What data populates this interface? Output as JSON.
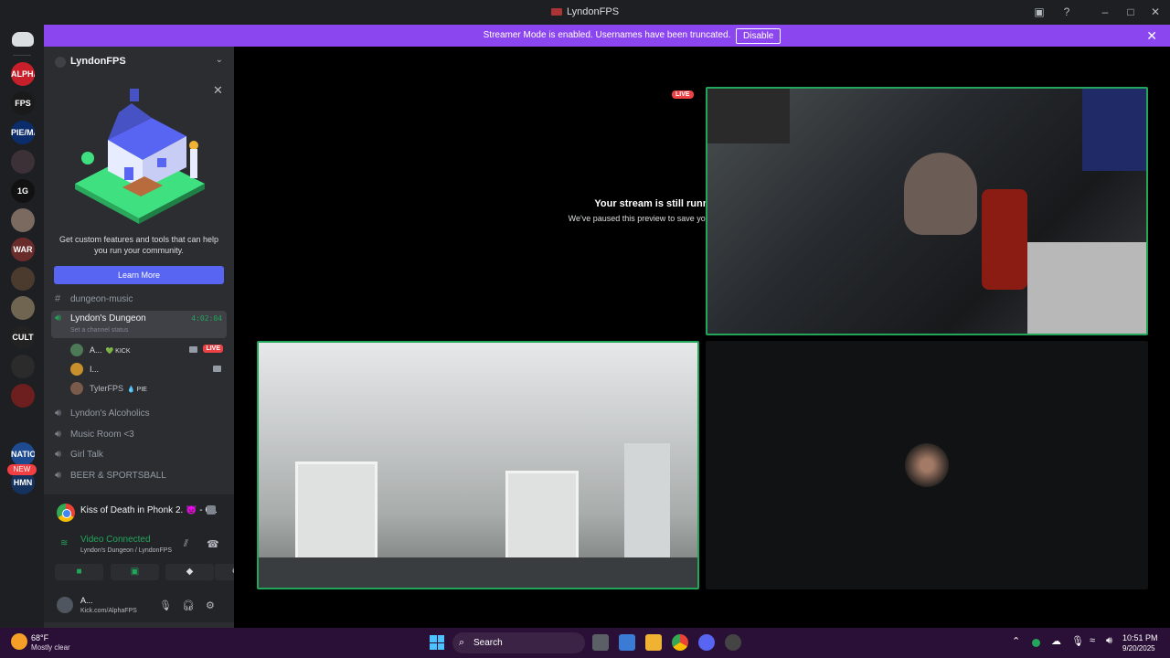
{
  "window": {
    "title": "LyndonFPS"
  },
  "banner": {
    "message": "Streamer Mode is enabled. Usernames have been truncated.",
    "disable_label": "Disable"
  },
  "rail": {
    "servers": [
      {
        "label": "ALPHA",
        "color": "#c8202a"
      },
      {
        "label": "FPS",
        "color": "#1a1a1a"
      },
      {
        "label": "PIE/MAN",
        "color": "#0c2d6b"
      },
      {
        "label": "",
        "color": "#3b3136"
      },
      {
        "label": "1G",
        "color": "#111"
      },
      {
        "label": "",
        "color": "#7a6a5f"
      },
      {
        "label": "WAR",
        "color": "#6a2b2b"
      },
      {
        "label": "",
        "color": "#4a3b2e"
      },
      {
        "label": "",
        "color": "#6f6551"
      },
      {
        "label": "CULT",
        "color": "#222"
      },
      {
        "label": "",
        "color": "#2b2b2b"
      },
      {
        "label": "",
        "color": "#6d1e1e"
      },
      {
        "label": "",
        "color": "#1e1f22"
      },
      {
        "label": "NATION",
        "color": "#1e4b8f"
      },
      {
        "label": "HMN",
        "color": "#15325e"
      }
    ],
    "new_badge": "NEW"
  },
  "sidebar": {
    "server_name": "LyndonFPS",
    "promo": {
      "text": "Get custom features and tools that can help you run your community.",
      "button": "Learn More"
    },
    "channels": [
      {
        "type": "text",
        "name": "dungeon-music"
      },
      {
        "type": "voice",
        "name": "Lyndon's Dungeon",
        "timer": "4:02:04",
        "status": "Set a channel status",
        "active": true
      },
      {
        "type": "voice",
        "name": "Lyndon's Alcoholics"
      },
      {
        "type": "voice",
        "name": "Music Room <3"
      },
      {
        "type": "voice",
        "name": "Girl Talk"
      },
      {
        "type": "voice",
        "name": "BEER & SPORTSBALL"
      }
    ],
    "voice_users": [
      {
        "name": "A...",
        "tag": "💚 KICK",
        "live": "LIVE"
      },
      {
        "name": "I...",
        "tag": ""
      },
      {
        "name": "TylerFPS",
        "tag": "💧 PIE"
      }
    ]
  },
  "activity": {
    "app_text": "Kiss of Death in Phonk 2. 👿      - G..."
  },
  "voice_panel": {
    "status": "Video Connected",
    "location": "Lyndon's Dungeon / LyndonFPS"
  },
  "user_panel": {
    "name": "A...",
    "status": "Kick.com/AlphaFPS"
  },
  "stage": {
    "paused_title": "Your stream is still running!",
    "paused_sub": "We've paused this preview to save your resources.",
    "live_badge": "LIVE"
  },
  "taskbar": {
    "weather_temp": "68°F",
    "weather_desc": "Mostly clear",
    "search_label": "Search",
    "time": "10:51 PM",
    "date": "9/20/2025"
  },
  "colors": {
    "accent": "#5865f2",
    "banner": "#8c46f0",
    "speaking": "#23a55a",
    "live": "#ed4245"
  }
}
